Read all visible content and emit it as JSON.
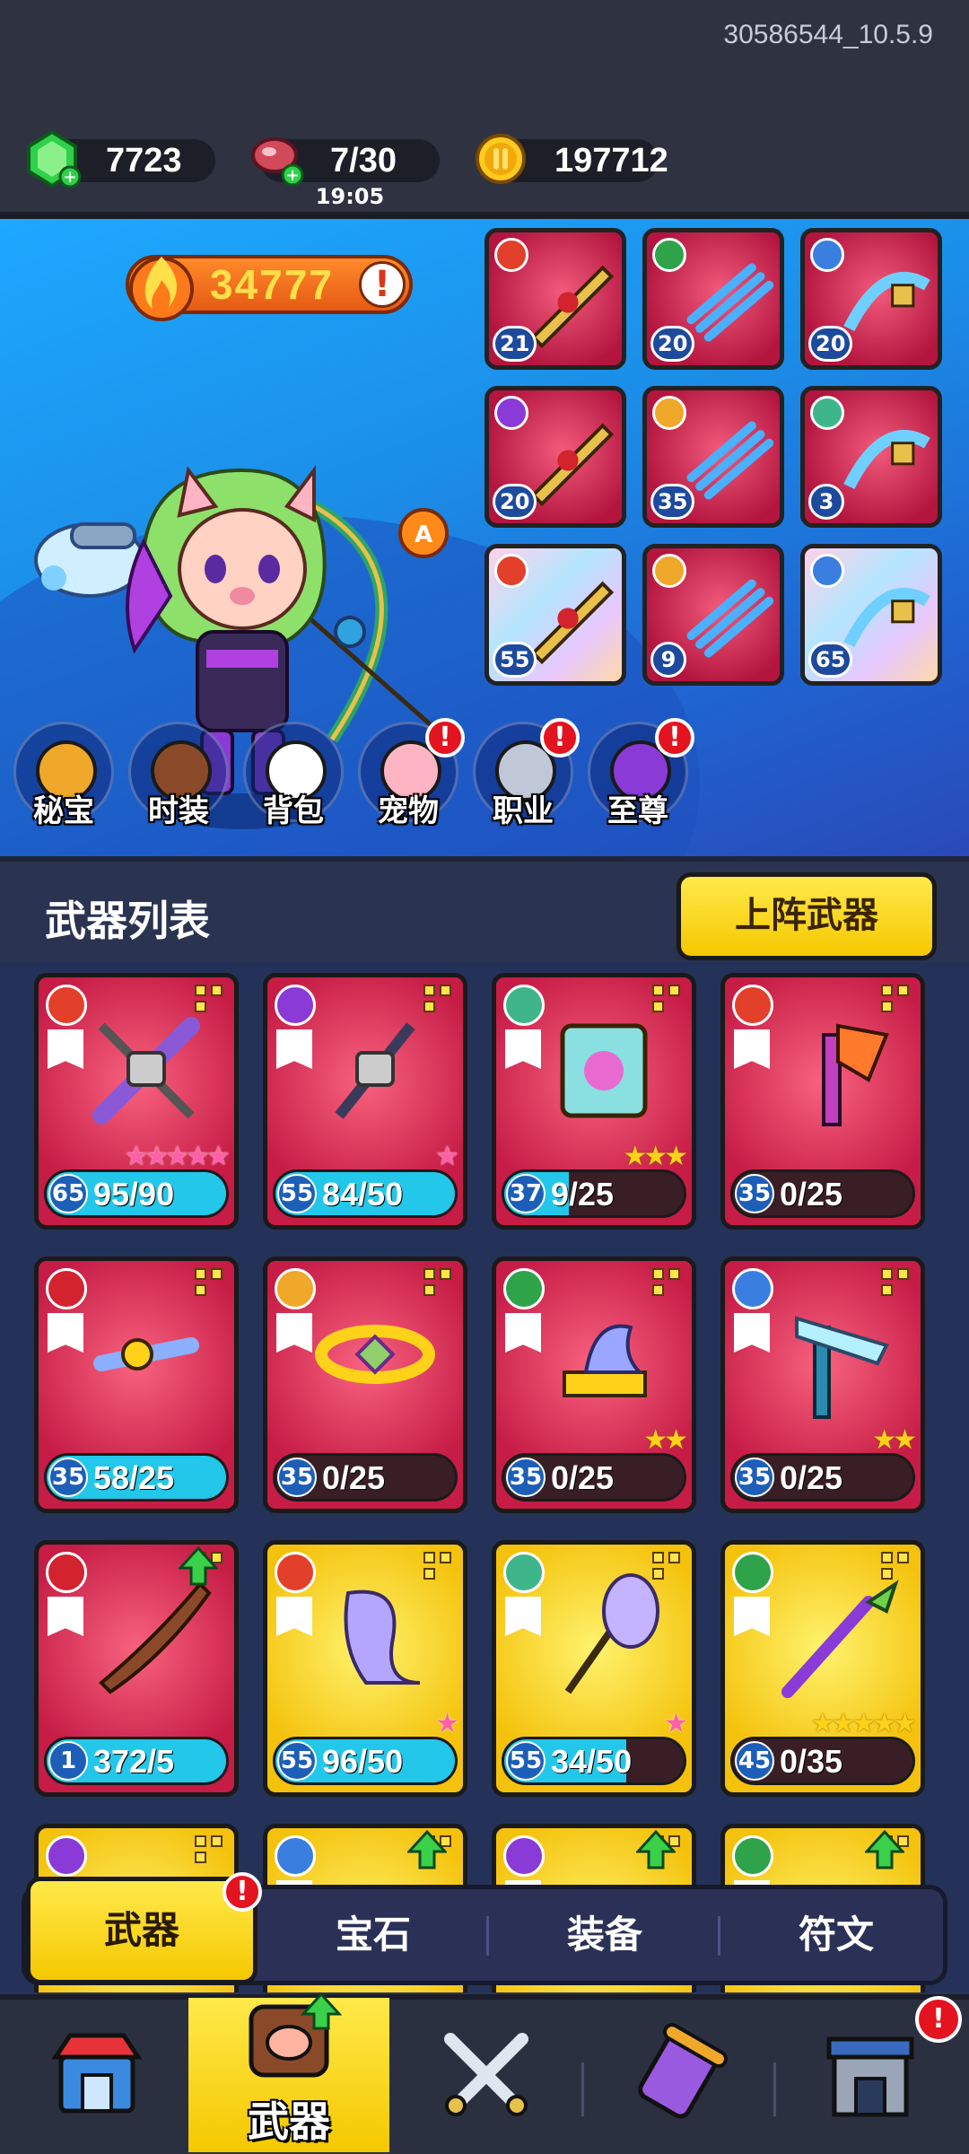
{
  "version": "30586544_10.5.9",
  "resources": {
    "gems": {
      "icon": "green-gem-icon",
      "value": "7723"
    },
    "stamina": {
      "icon": "meat-icon",
      "value": "7/30",
      "timer": "19:05"
    },
    "coins": {
      "icon": "gold-coin-icon",
      "value": "197712"
    }
  },
  "hero": {
    "power": "34777",
    "info": "!",
    "equipped": [
      {
        "level": "21",
        "element": "fire",
        "bg": "red"
      },
      {
        "level": "20",
        "element": "nature",
        "bg": "red"
      },
      {
        "level": "20",
        "element": "ice",
        "bg": "red"
      },
      {
        "level": "20",
        "element": "lightning",
        "bg": "red"
      },
      {
        "level": "35",
        "element": "holy",
        "bg": "red"
      },
      {
        "level": "3",
        "element": "wind",
        "bg": "red"
      },
      {
        "level": "55",
        "element": "fire",
        "bg": "rainbow"
      },
      {
        "level": "9",
        "element": "holy",
        "bg": "red"
      },
      {
        "level": "65",
        "element": "ice",
        "bg": "rainbow"
      }
    ],
    "menu": [
      {
        "label": "秘宝",
        "icon": "treasure-pot-icon",
        "badge": ""
      },
      {
        "label": "时装",
        "icon": "cowboy-hat-icon",
        "badge": ""
      },
      {
        "label": "背包",
        "icon": "robot-backpack-icon",
        "badge": ""
      },
      {
        "label": "宠物",
        "icon": "paw-icon",
        "badge": "!"
      },
      {
        "label": "职业",
        "icon": "sword-shield-icon",
        "badge": "!"
      },
      {
        "label": "至尊",
        "icon": "purple-gem-icon",
        "badge": "!"
      }
    ]
  },
  "weapon_list": {
    "title": "武器列表",
    "deploy_button": "上阵武器",
    "cards": [
      {
        "level": "65",
        "count": "95/90",
        "progress": 1.0,
        "bg": "red",
        "element": "fire",
        "stars": "★★★★★",
        "star_color": "pink",
        "locked": true
      },
      {
        "level": "55",
        "count": "84/50",
        "progress": 1.0,
        "bg": "red",
        "element": "lightning",
        "stars": "★",
        "star_color": "pink",
        "locked": true
      },
      {
        "level": "37",
        "count": "9/25",
        "progress": 0.36,
        "bg": "red",
        "element": "wind",
        "stars": "★★★",
        "star_color": "yellow",
        "locked": false
      },
      {
        "level": "35",
        "count": "0/25",
        "progress": 0,
        "bg": "red",
        "element": "fire",
        "stars": "",
        "star_color": "yellow",
        "locked": false
      },
      {
        "level": "35",
        "count": "58/25",
        "progress": 1.0,
        "bg": "red",
        "element": "blood",
        "stars": "",
        "star_color": "yellow",
        "locked": false
      },
      {
        "level": "35",
        "count": "0/25",
        "progress": 0,
        "bg": "red",
        "element": "holy",
        "stars": "",
        "star_color": "yellow",
        "locked": false
      },
      {
        "level": "35",
        "count": "0/25",
        "progress": 0,
        "bg": "red",
        "element": "nature",
        "stars": "★★",
        "star_color": "yellow",
        "locked": false
      },
      {
        "level": "35",
        "count": "0/25",
        "progress": 0,
        "bg": "red",
        "element": "ice",
        "stars": "★★",
        "star_color": "yellow",
        "locked": false
      },
      {
        "level": "1",
        "count": "372/5",
        "progress": 1.0,
        "bg": "red",
        "element": "blood",
        "stars": "",
        "star_color": "yellow",
        "locked": false,
        "upgrade": true
      },
      {
        "level": "55",
        "count": "96/50",
        "progress": 1.0,
        "bg": "gold",
        "element": "fire",
        "stars": "★",
        "star_color": "pink",
        "locked": false
      },
      {
        "level": "55",
        "count": "34/50",
        "progress": 0.68,
        "bg": "gold",
        "element": "wind",
        "stars": "★",
        "star_color": "pink",
        "locked": false
      },
      {
        "level": "45",
        "count": "0/35",
        "progress": 0,
        "bg": "gold",
        "element": "nature",
        "stars": "★★★★★",
        "star_color": "yellow",
        "locked": false
      },
      {
        "level": "",
        "count": "",
        "progress": 0,
        "bg": "gold",
        "element": "lightning",
        "stars": "",
        "star_color": "yellow",
        "locked": false
      },
      {
        "level": "",
        "count": "",
        "progress": 0,
        "bg": "gold",
        "element": "ice",
        "stars": "",
        "star_color": "yellow",
        "locked": false,
        "upgrade": true
      },
      {
        "level": "",
        "count": "",
        "progress": 0,
        "bg": "gold",
        "element": "lightning",
        "stars": "",
        "star_color": "yellow",
        "locked": false,
        "upgrade": true
      },
      {
        "level": "",
        "count": "",
        "progress": 0,
        "bg": "gold",
        "element": "nature",
        "stars": "",
        "star_color": "yellow",
        "locked": false,
        "upgrade": true
      }
    ]
  },
  "subtabs": [
    {
      "label": "武器",
      "active": true,
      "badge": "!"
    },
    {
      "label": "宝石",
      "active": false,
      "badge": ""
    },
    {
      "label": "装备",
      "active": false,
      "badge": ""
    },
    {
      "label": "符文",
      "active": false,
      "badge": ""
    }
  ],
  "bottom_nav": [
    {
      "icon": "shop-icon",
      "label": "",
      "active": false,
      "badge": ""
    },
    {
      "icon": "weapon-chest-icon",
      "label": "武器",
      "active": true,
      "badge": ""
    },
    {
      "icon": "crossed-swords-icon",
      "label": "",
      "active": false,
      "badge": ""
    },
    {
      "icon": "scroll-icon",
      "label": "",
      "active": false,
      "badge": ""
    },
    {
      "icon": "building-icon",
      "label": "",
      "active": false,
      "badge": "!"
    }
  ],
  "colors": {
    "fire": "#e2402a",
    "nature": "#2fa34a",
    "ice": "#3a7fe0",
    "lightning": "#8a3ad6",
    "holy": "#f0a82a",
    "wind": "#3fb58a",
    "blood": "#d2232e",
    "accent_yellow": "#f5c800",
    "badge_red": "#e3131f",
    "progress_cyan": "#22c7ea"
  }
}
